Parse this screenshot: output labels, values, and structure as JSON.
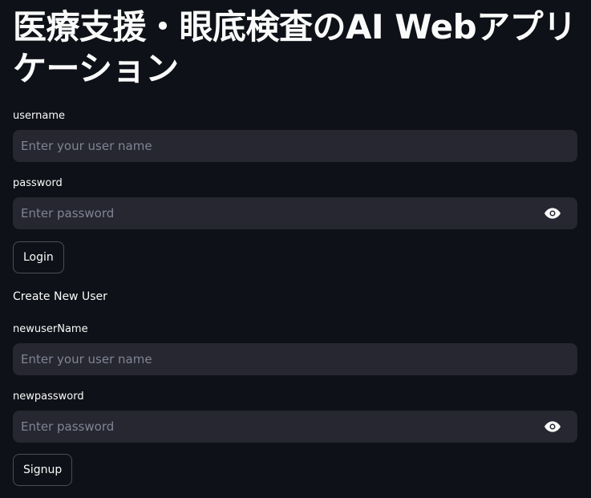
{
  "page": {
    "title": "医療支援・眼底検査のAI Webアプリケーション"
  },
  "login": {
    "username_label": "username",
    "username_placeholder": "Enter your user name",
    "password_label": "password",
    "password_placeholder": "Enter password",
    "password_icon": "eye-icon",
    "login_button": "Login"
  },
  "signup": {
    "section_title": "Create New User",
    "newusername_label": "newuserName",
    "newusername_placeholder": "Enter your user name",
    "newpassword_label": "newpassword",
    "newpassword_placeholder": "Enter password",
    "newpassword_icon": "eye-icon",
    "signup_button": "Signup"
  }
}
